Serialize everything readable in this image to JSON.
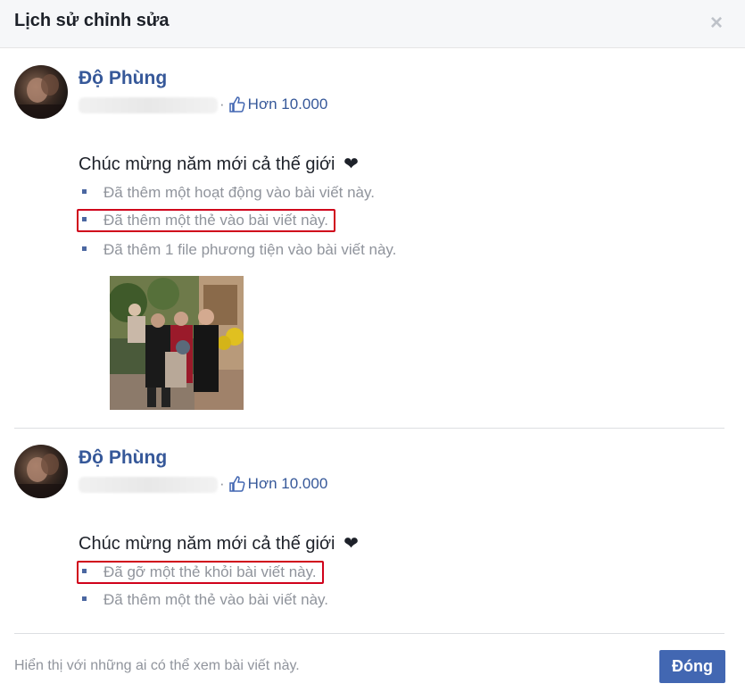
{
  "dialog": {
    "title": "Lịch sử chỉnh sửa",
    "close_icon": "×"
  },
  "entries": [
    {
      "author": "Độ Phùng",
      "separator": "·",
      "likes": "Hơn 10.000",
      "text": "Chúc mừng năm mới cả thế giới",
      "heart": "❤",
      "changes": [
        {
          "text": "Đã thêm một hoạt động vào bài viết này.",
          "highlighted": false
        },
        {
          "text": "Đã thêm một thẻ vào bài viết này.",
          "highlighted": true
        },
        {
          "text": "Đã thêm 1 file phương tiện vào bài viết này.",
          "highlighted": false
        }
      ]
    },
    {
      "author": "Độ Phùng",
      "separator": "·",
      "likes": "Hơn 10.000",
      "text": "Chúc mừng năm mới cả thế giới",
      "heart": "❤",
      "changes": [
        {
          "text": "Đã gỡ một thẻ khỏi bài viết này.",
          "highlighted": true
        },
        {
          "text": "Đã thêm một thẻ vào bài viết này.",
          "highlighted": false
        }
      ]
    }
  ],
  "footer": {
    "visibility_text": "Hiển thị với những ai có thể xem bài viết này.",
    "close_button": "Đóng"
  },
  "colors": {
    "link": "#365899",
    "button": "#4267b2",
    "highlight_border": "#d0021b",
    "muted_text": "#90949c"
  },
  "icons": [
    "close-icon",
    "like-icon",
    "heart-icon",
    "bullet-icon"
  ]
}
